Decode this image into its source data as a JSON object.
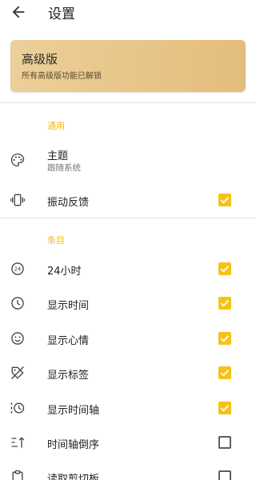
{
  "appbar": {
    "title": "设置"
  },
  "premium": {
    "title": "高级版",
    "subtitle": "所有高级版功能已解锁"
  },
  "sections": {
    "general": {
      "header": "通用",
      "theme": {
        "label": "主题",
        "value": "跟随系统"
      },
      "vibration": {
        "label": "振动反馈",
        "checked": true
      }
    },
    "entries": {
      "header": "条目",
      "items": [
        {
          "label": "24小时",
          "icon": "24-hour-icon",
          "checked": true
        },
        {
          "label": "显示时间",
          "icon": "clock-icon",
          "checked": true
        },
        {
          "label": "显示心情",
          "icon": "smiley-icon",
          "checked": true
        },
        {
          "label": "显示标签",
          "icon": "tag-off-icon",
          "checked": true
        },
        {
          "label": "显示时间轴",
          "icon": "timeline-icon",
          "checked": true
        },
        {
          "label": "时间轴倒序",
          "icon": "sort-ascending-icon",
          "checked": false
        },
        {
          "label": "读取剪切板",
          "icon": "clipboard-icon",
          "checked": false
        }
      ]
    }
  },
  "colors": {
    "accent": "#f5c318",
    "section_header": "#f5b818",
    "premium_gradient_start": "#eccf9a",
    "premium_gradient_end": "#e4bd7b"
  }
}
